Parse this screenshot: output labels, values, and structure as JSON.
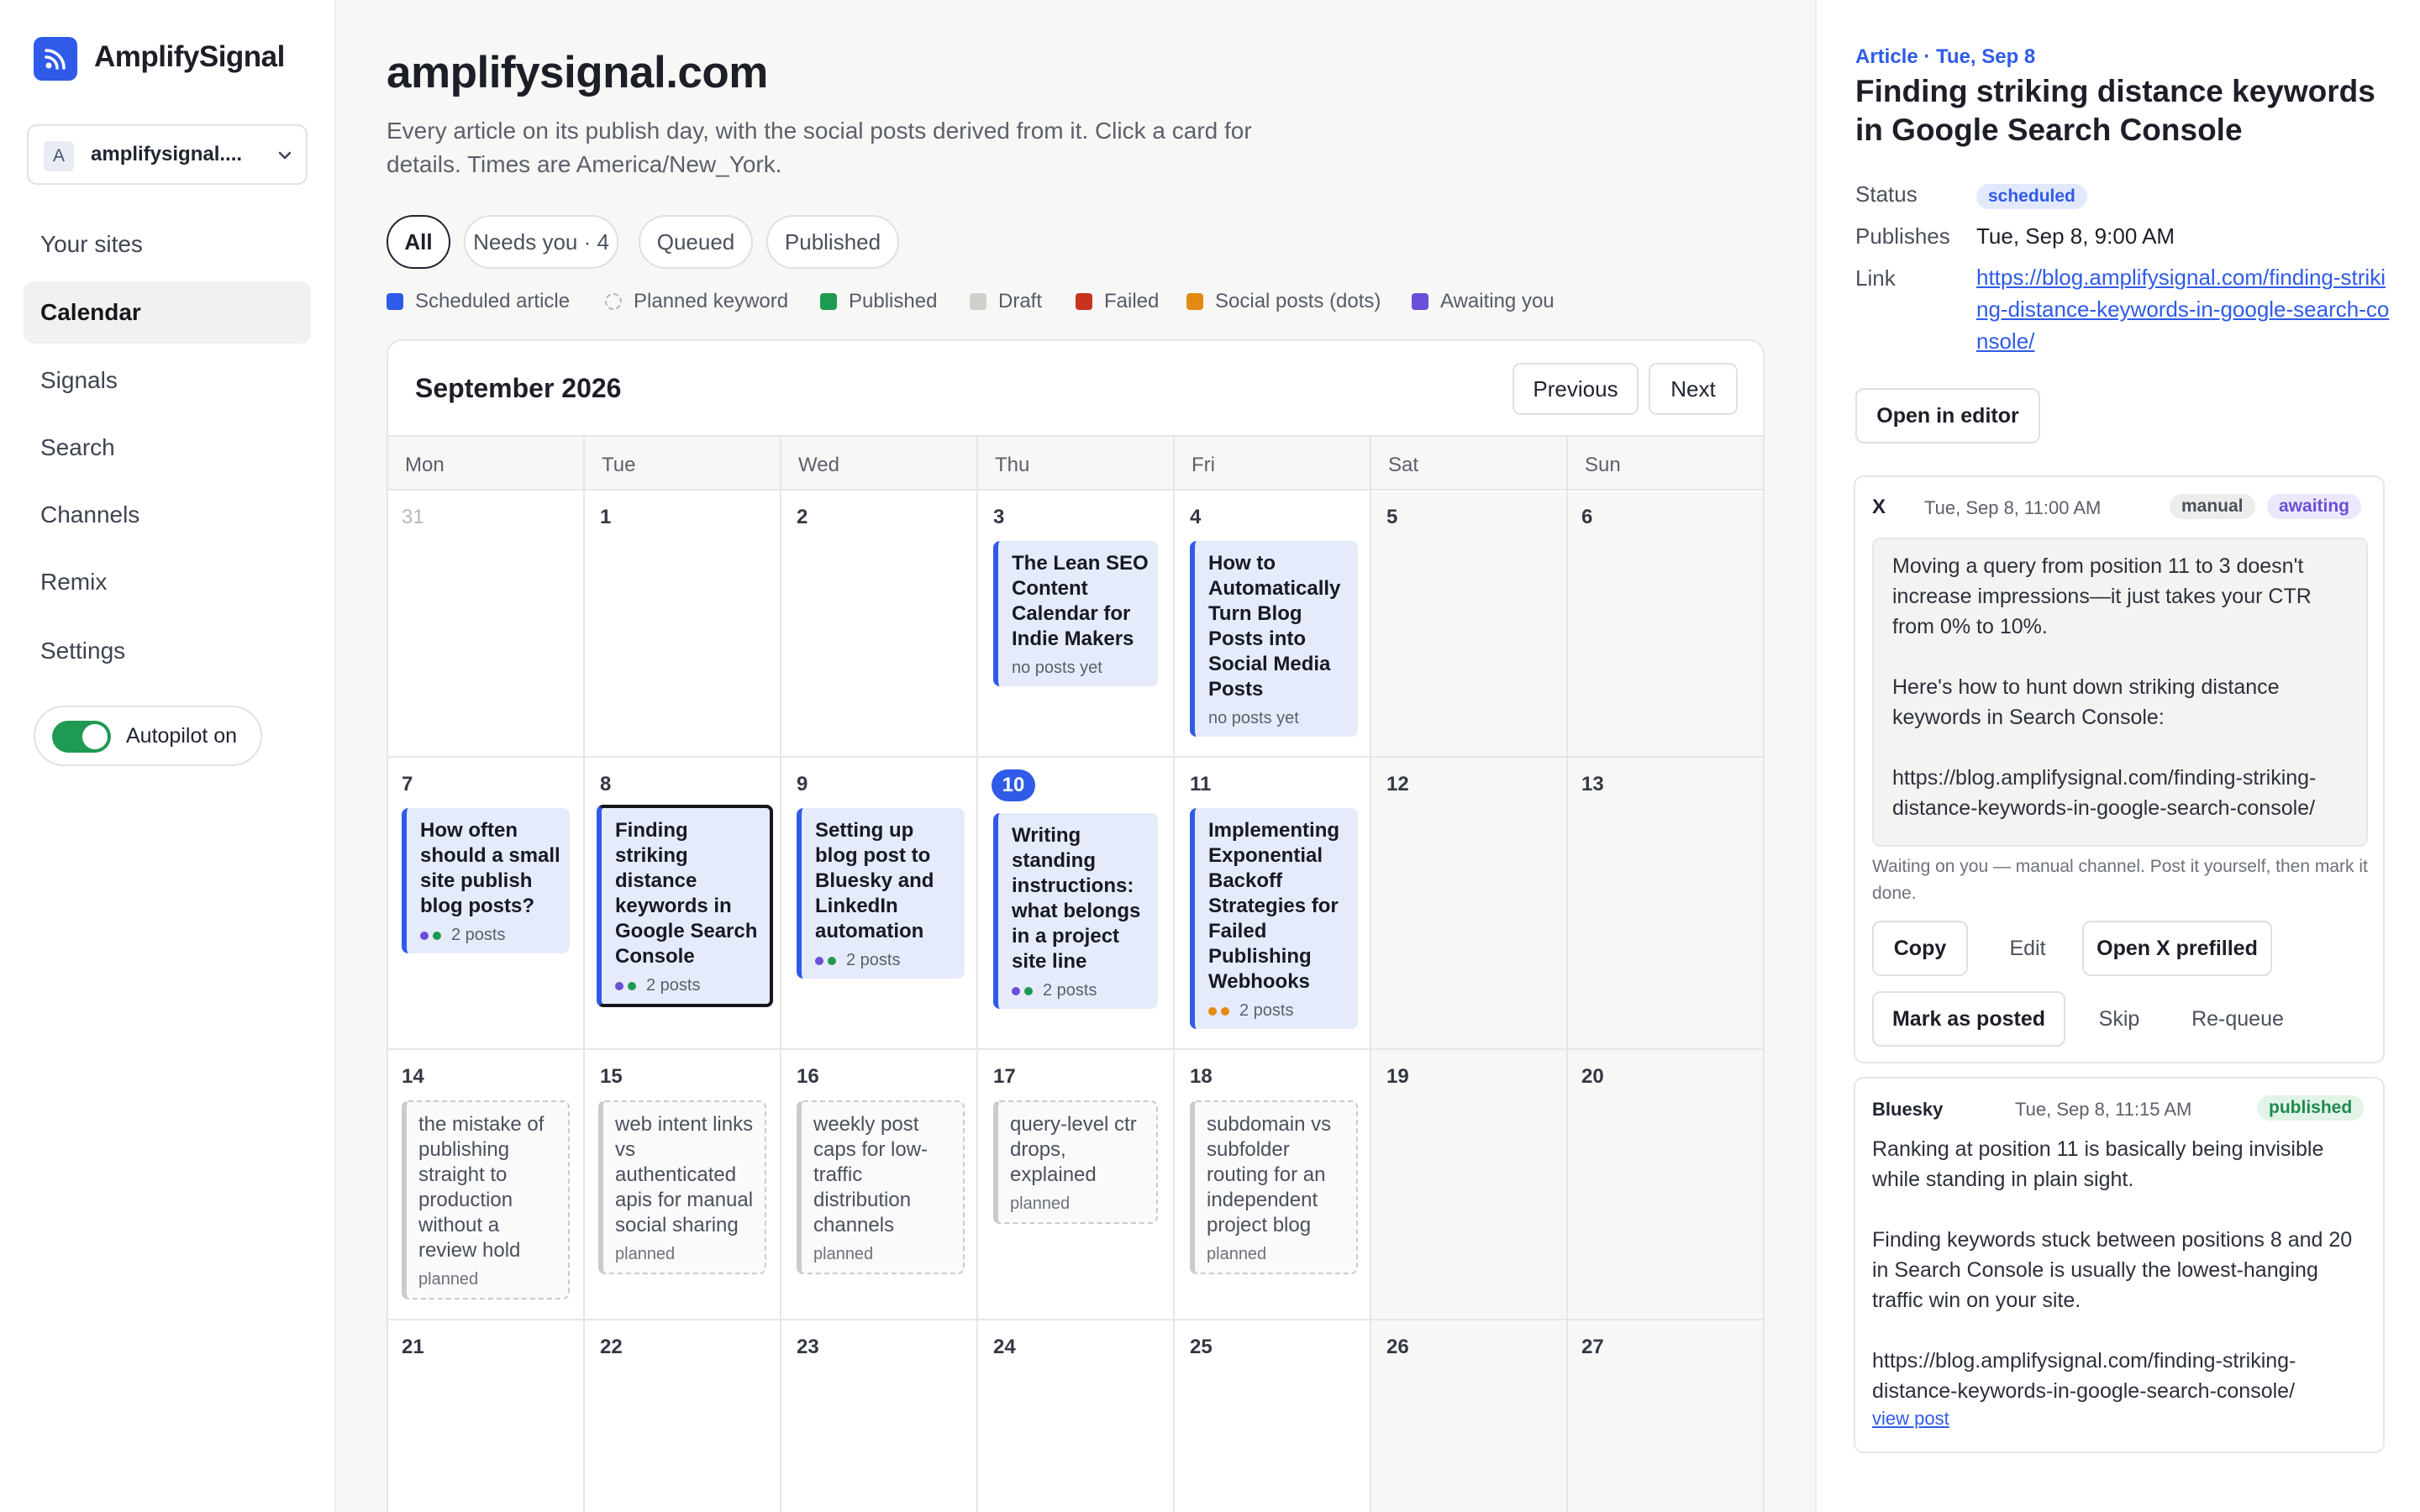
{
  "brand": {
    "name": "AmplifySignal",
    "logo_icon": "rss-icon",
    "accent": "#2f5be8"
  },
  "site_selector": {
    "avatar": "A",
    "value": "amplifysignal...."
  },
  "nav": [
    {
      "label": "Your sites",
      "active": false
    },
    {
      "label": "Calendar",
      "active": true
    },
    {
      "label": "Signals",
      "active": false
    },
    {
      "label": "Search",
      "active": false
    },
    {
      "label": "Channels",
      "active": false
    },
    {
      "label": "Remix",
      "active": false
    },
    {
      "label": "Settings",
      "active": false
    }
  ],
  "autopilot": {
    "label": "Autopilot on",
    "enabled": true
  },
  "main": {
    "title": "amplifysignal.com",
    "description": "Every article on its publish day, with the social posts derived from it. Click a card for details. Times are America/New_York.",
    "filters": [
      "All",
      "Needs you · 4",
      "Queued",
      "Published"
    ],
    "legend": [
      {
        "label": "Scheduled article",
        "color": "#2f5be8"
      },
      {
        "label": "Planned keyword",
        "color": "dashed"
      },
      {
        "label": "Published",
        "color": "#1f9a52"
      },
      {
        "label": "Draft",
        "color": "#cfd0cc"
      },
      {
        "label": "Failed",
        "color": "#c8321f"
      },
      {
        "label": "Social posts (dots)",
        "color": "#e38a12"
      },
      {
        "label": "Awaiting you",
        "color": "#6b4fd8"
      }
    ]
  },
  "calendar": {
    "month": "September 2026",
    "prev_label": "Previous",
    "next_label": "Next",
    "weekdays": [
      "Mon",
      "Tue",
      "Wed",
      "Thu",
      "Fri",
      "Sat",
      "Sun"
    ],
    "weeks": [
      [
        "31",
        "1",
        "2",
        "3",
        "4",
        "5",
        "6"
      ],
      [
        "7",
        "8",
        "9",
        "10",
        "11",
        "12",
        "13"
      ],
      [
        "14",
        "15",
        "16",
        "17",
        "18",
        "19",
        "20"
      ],
      [
        "21",
        "22",
        "23",
        "24",
        "25",
        "26",
        "27"
      ]
    ],
    "today": "10",
    "articles": {
      "w0d3": {
        "title": "The Lean SEO Content Calendar for Indie Makers",
        "meta": "no posts yet"
      },
      "w0d4": {
        "title": "How to Automatically Turn Blog Posts into Social Media Posts",
        "meta": "no posts yet"
      },
      "w1d0": {
        "title": "How often should a small site publish blog posts?",
        "meta": "2 posts"
      },
      "w1d1": {
        "title": "Finding striking distance keywords in Google Search Console",
        "meta": "2 posts"
      },
      "w1d2": {
        "title": "Setting up blog post to Bluesky and LinkedIn automation",
        "meta": "2 posts"
      },
      "w1d3": {
        "title": "Writing standing instructions: what belongs in a project site line",
        "meta": "2 posts"
      },
      "w1d4": {
        "title": "Implementing Exponential Backoff Strategies for Failed Publishing Webhooks",
        "meta": "2 posts"
      }
    },
    "planned": {
      "w2d0": {
        "title": "the mistake of publishing straight to production without a review hold",
        "meta": "planned"
      },
      "w2d1": {
        "title": "web intent links vs authenticated apis for manual social sharing",
        "meta": "planned"
      },
      "w2d2": {
        "title": "weekly post caps for low-traffic distribution channels",
        "meta": "planned"
      },
      "w2d3": {
        "title": "query-level ctr drops, explained",
        "meta": "planned"
      },
      "w2d4": {
        "title": "subdomain vs subfolder routing for an independent project blog",
        "meta": "planned"
      }
    }
  },
  "panel": {
    "kicker": "Article · Tue, Sep 8",
    "title": "Finding striking distance keywords in Google Search Console",
    "status_label": "Status",
    "status_value": "scheduled",
    "publishes_label": "Publishes",
    "publishes_value": "Tue, Sep 8, 9:00 AM",
    "link_label": "Link",
    "link_value": "https://blog.amplifysignal.com/finding-striking-distance-keywords-in-google-search-console/",
    "open_editor": "Open in editor",
    "posts": [
      {
        "channel": "X",
        "time": "Tue, Sep 8, 11:00 AM",
        "mode": "manual",
        "status": "awaiting",
        "body": "Moving a query from position 11 to 3 doesn't increase impressions—it just takes your CTR from 0% to 10%.\n\nHere's how to hunt down striking distance keywords in Search Console:\n\nhttps://blog.amplifysignal.com/finding-striking-distance-keywords-in-google-search-console/",
        "note": "Waiting on you — manual channel. Post it yourself, then mark it done.",
        "actions": {
          "copy": "Copy",
          "edit": "Edit",
          "open": "Open X prefilled",
          "mark": "Mark as posted",
          "skip": "Skip",
          "requeue": "Re-queue"
        }
      },
      {
        "channel": "Bluesky",
        "time": "Tue, Sep 8, 11:15 AM",
        "status": "published",
        "body": "Ranking at position 11 is basically being invisible while standing in plain sight.\n\nFinding keywords stuck between positions 8 and 20 in Search Console is usually the lowest-hanging traffic win on your site.\n\nhttps://blog.amplifysignal.com/finding-striking-distance-keywords-in-google-search-console/",
        "view_link": "view post"
      }
    ]
  }
}
